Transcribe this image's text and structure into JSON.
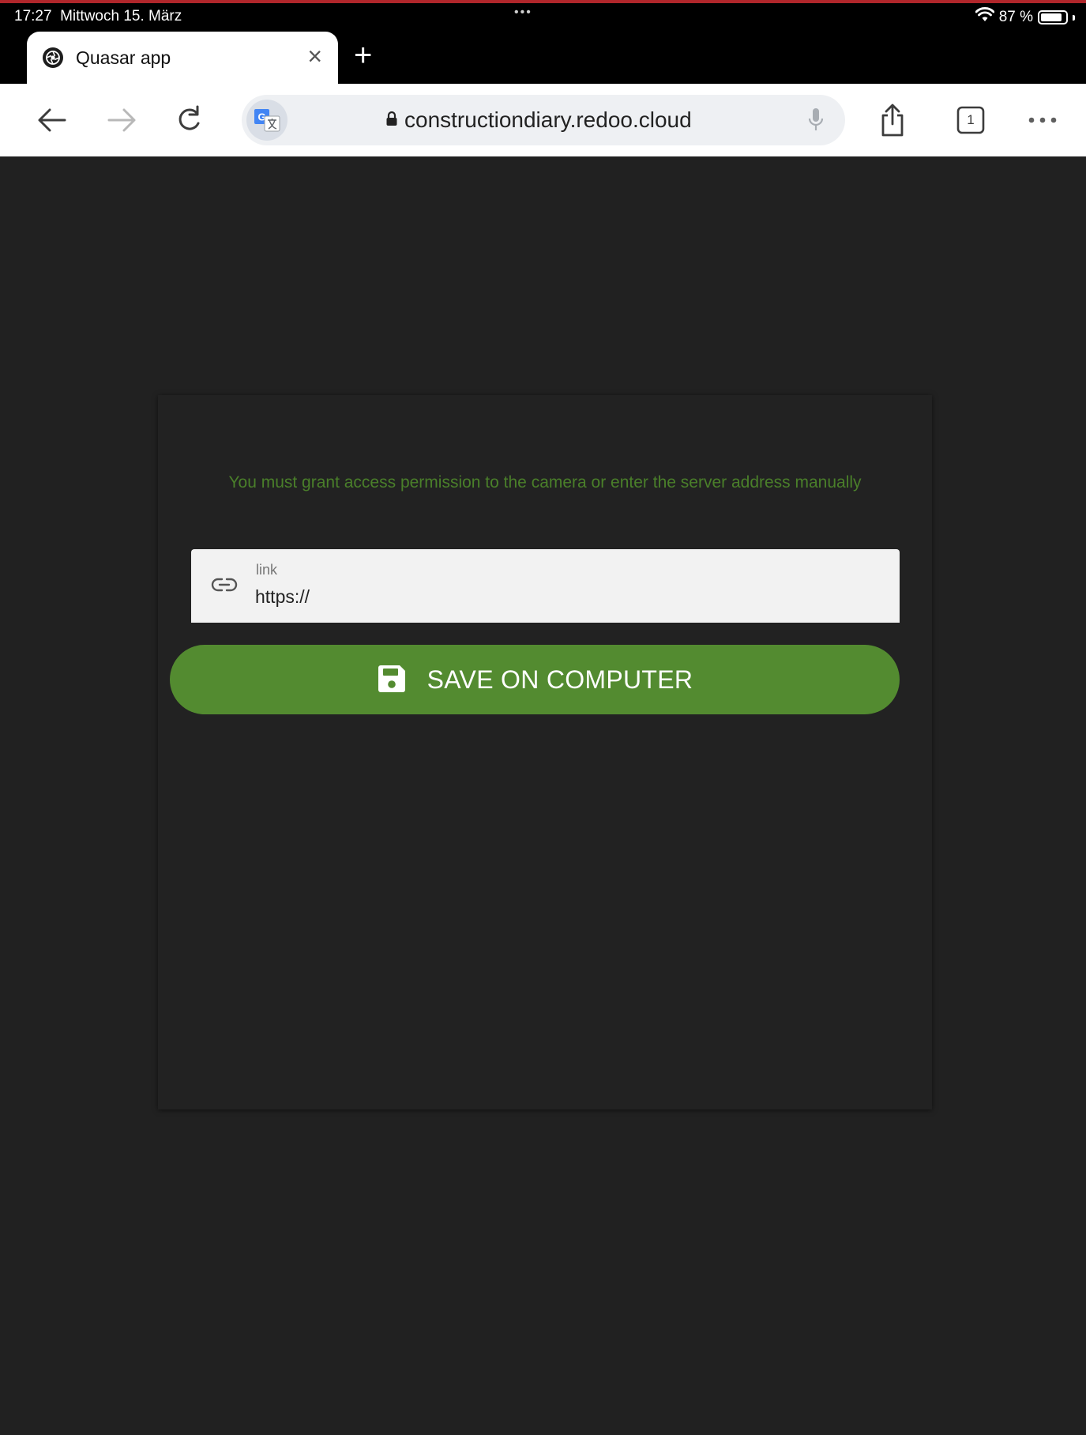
{
  "status_bar": {
    "time": "17:27",
    "date": "Mittwoch 15. März",
    "dots": "•••",
    "battery_percent": "87 %",
    "battery_level": 0.87
  },
  "browser": {
    "tab_title": "Quasar app",
    "url": "constructiondiary.redoo.cloud",
    "tab_count": "1",
    "icons": {
      "back": "arrow-left-icon",
      "forward": "arrow-right-icon",
      "reload": "reload-icon",
      "translate": "translate-icon",
      "lock": "lock-icon",
      "mic": "microphone-icon",
      "share": "share-icon",
      "tabs": "tabs-icon",
      "menu": "more-icon"
    }
  },
  "page": {
    "message": "You must grant access permission to the camera or enter the server address manually",
    "link_field": {
      "label": "link",
      "value": "https://"
    },
    "save_button_label": "SAVE ON COMPUTER"
  },
  "colors": {
    "background": "#212121",
    "accent": "#538b30",
    "message_text": "#4a7f2a",
    "status_accent": "#b0262b"
  }
}
